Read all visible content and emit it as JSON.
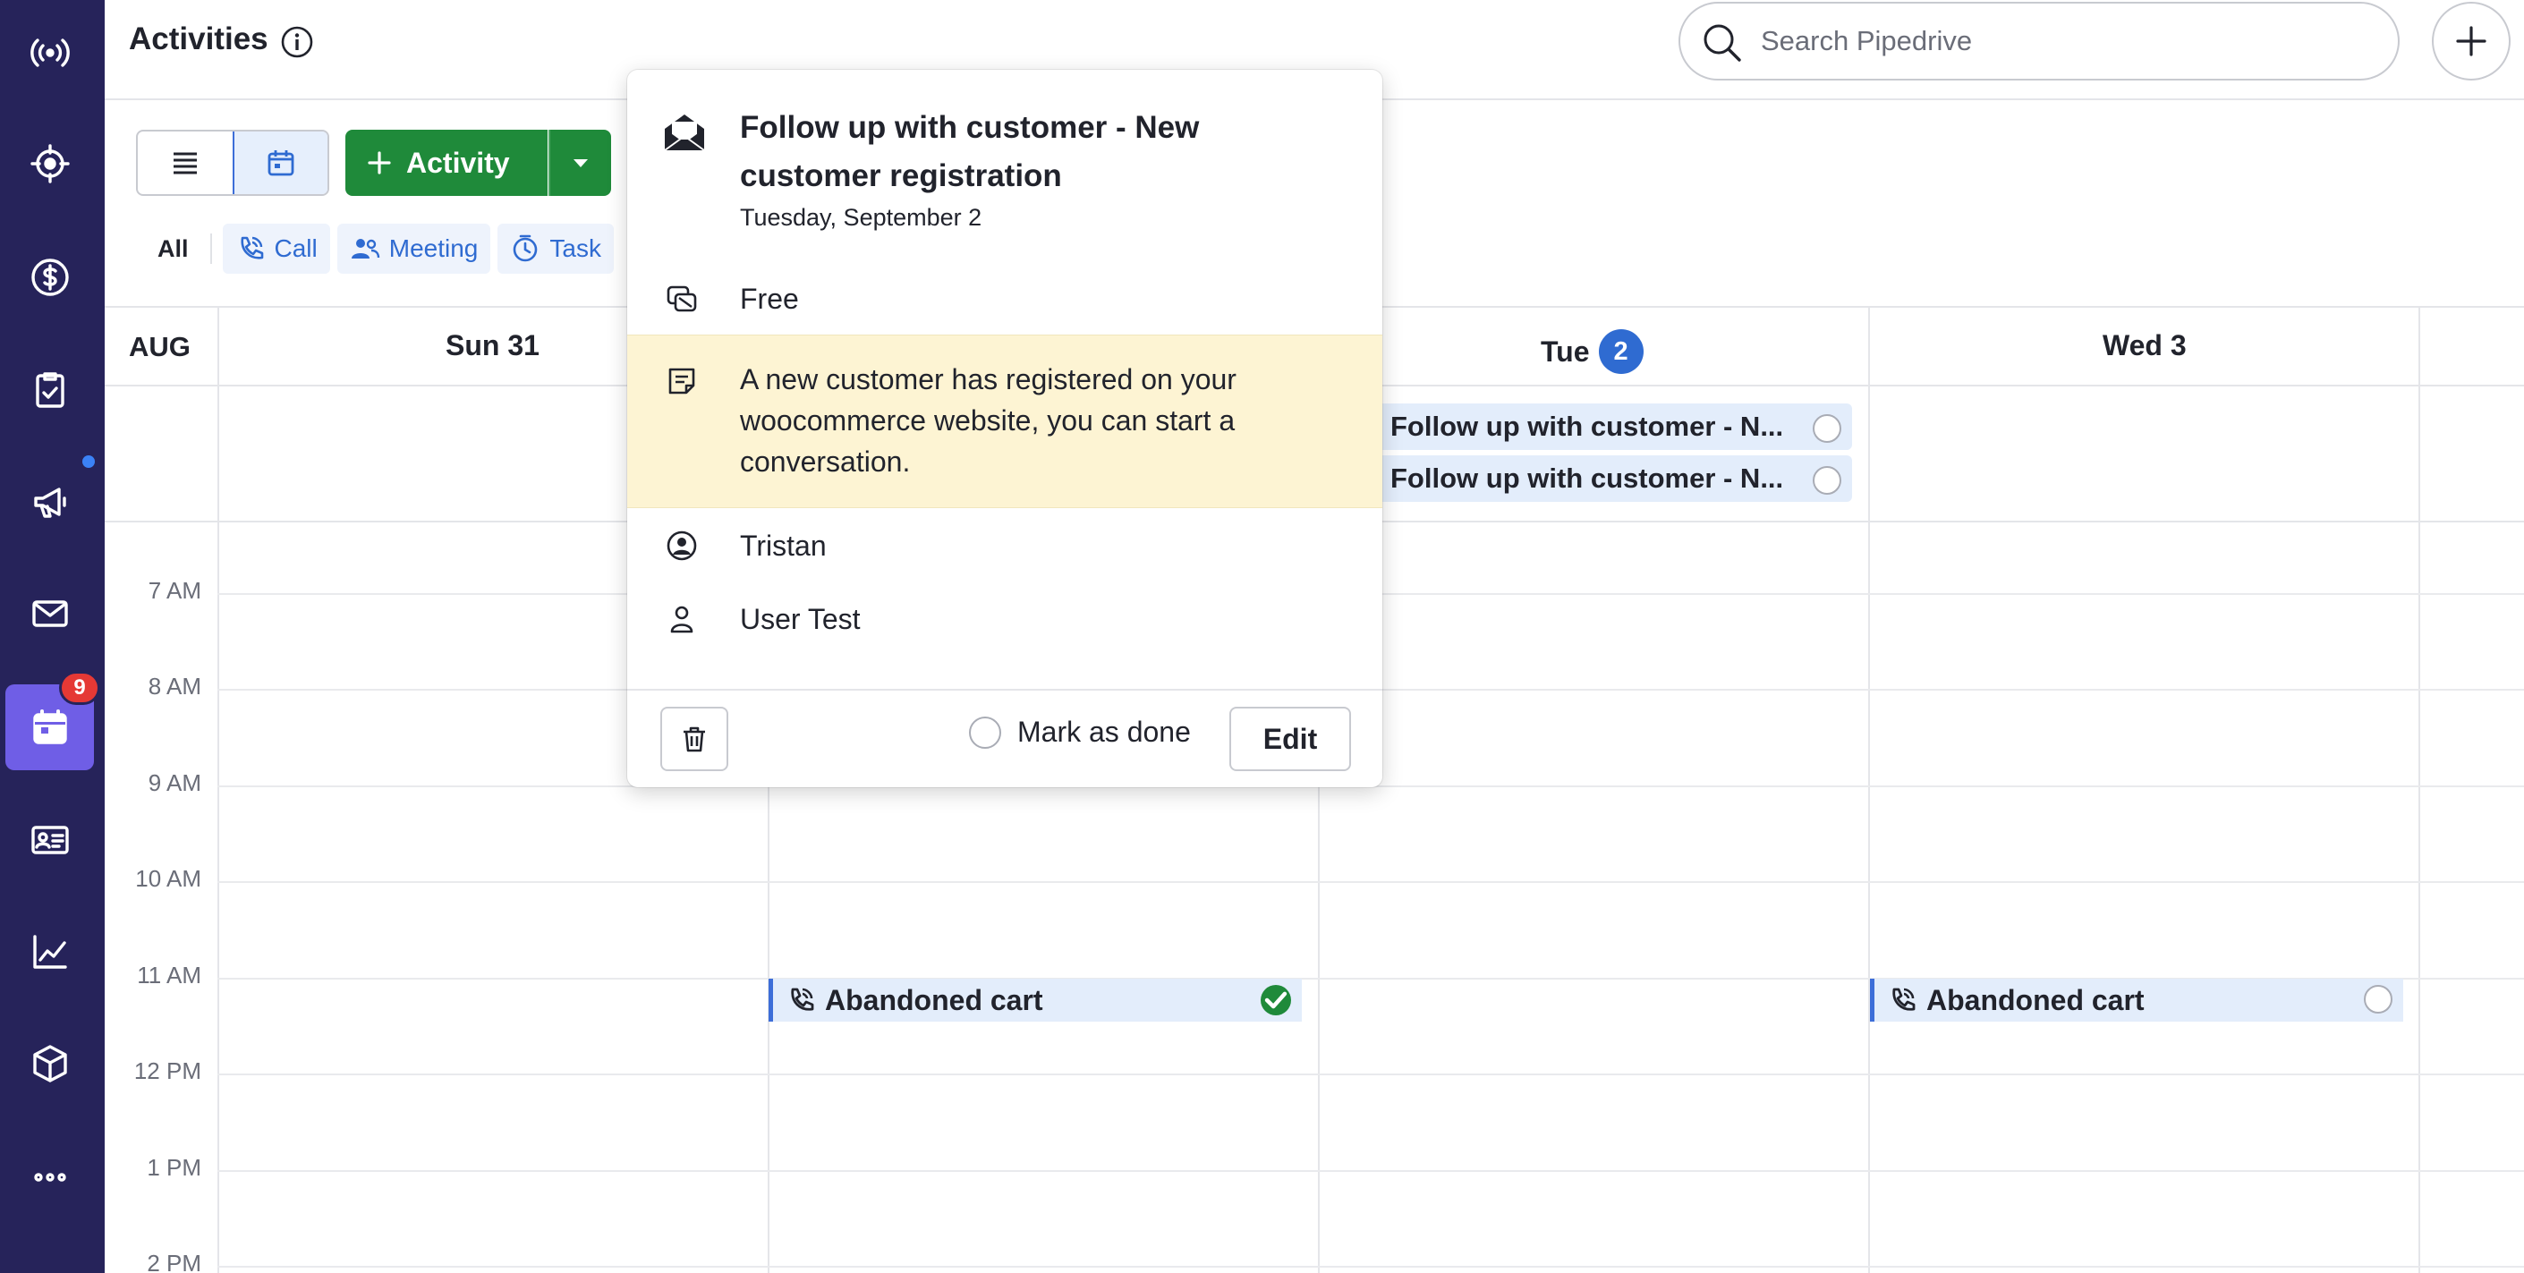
{
  "header": {
    "title": "Activities",
    "search_placeholder": "Search Pipedrive"
  },
  "sidebar": {
    "items": [
      {
        "name": "radar",
        "icon": "broadcast-icon"
      },
      {
        "name": "leads",
        "icon": "target-icon"
      },
      {
        "name": "deals",
        "icon": "dollar-icon"
      },
      {
        "name": "projects",
        "icon": "clipboard-check-icon"
      },
      {
        "name": "campaigns",
        "icon": "megaphone-icon"
      },
      {
        "name": "mail",
        "icon": "mail-icon"
      },
      {
        "name": "activities",
        "icon": "calendar-icon",
        "active": true
      },
      {
        "name": "contacts",
        "icon": "contact-card-icon"
      },
      {
        "name": "insights",
        "icon": "chart-icon"
      },
      {
        "name": "products",
        "icon": "box-icon"
      },
      {
        "name": "more",
        "icon": "more-icon"
      }
    ],
    "activities_badge": "9"
  },
  "toolbar": {
    "activity_label": "Activity",
    "filters": {
      "all": "All",
      "call": "Call",
      "meeting": "Meeting",
      "task": "Task"
    }
  },
  "calendar": {
    "month": "AUG",
    "days": [
      {
        "label": "Sun 31"
      },
      {
        "label": "Tue",
        "badge": "2"
      },
      {
        "label": "Wed 3"
      }
    ],
    "times": [
      "7 AM",
      "8 AM",
      "9 AM",
      "10 AM",
      "11 AM",
      "12 PM",
      "1 PM",
      "2 PM"
    ],
    "allday_events": [
      {
        "title": "Follow up with customer - N..."
      },
      {
        "title": "Follow up with customer - N..."
      }
    ],
    "timed_events": [
      {
        "title": "Abandoned cart",
        "done": true
      },
      {
        "title": "Abandoned cart",
        "done": false
      }
    ]
  },
  "popover": {
    "title": "Follow up with customer - New customer registration",
    "date": "Tuesday, September 2",
    "availability": "Free",
    "note": "A new customer has registered on your woocommerce website, you can start a conversation.",
    "person": "Tristan",
    "owner": "User Test",
    "mark_done_label": "Mark as done",
    "edit_label": "Edit"
  },
  "colors": {
    "sidebar_bg": "#26235a",
    "active_nav": "#6f5ee6",
    "primary_green": "#1f8a3a",
    "accent_blue": "#2f6bd1",
    "note_bg": "#fdf4d3",
    "badge_red": "#e53935"
  }
}
